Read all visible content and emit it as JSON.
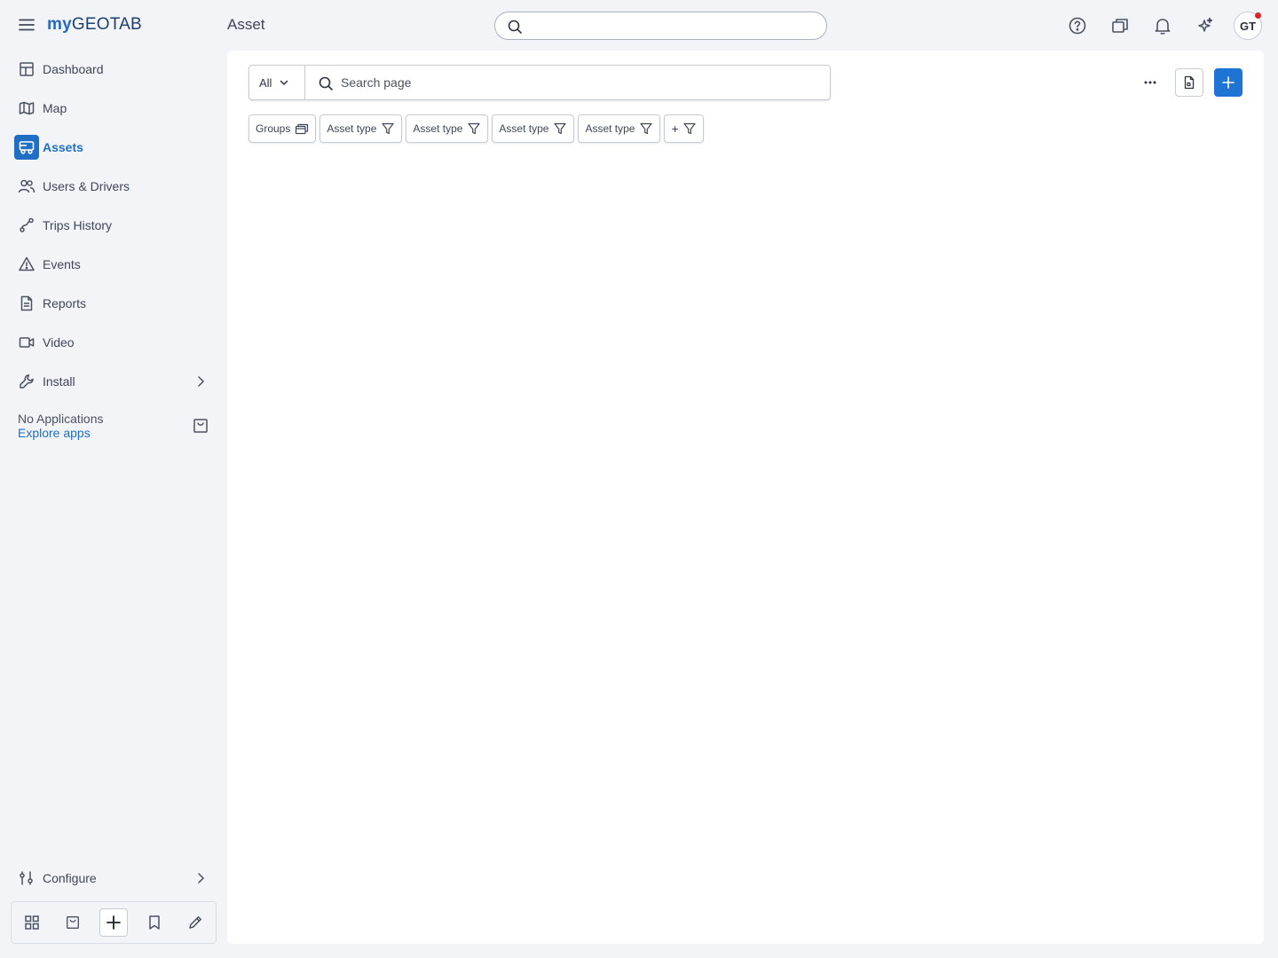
{
  "brand": {
    "logo_my": "my",
    "logo_geotab": "GEOTAB"
  },
  "header": {
    "page_title": "Asset",
    "search_placeholder": "",
    "avatar_initials": "GT",
    "icons": [
      "help-circle-icon",
      "news-icon",
      "bell-icon",
      "sparkle-ai-icon"
    ]
  },
  "sidebar": {
    "items": [
      {
        "label": "Dashboard",
        "icon": "dashboard-icon"
      },
      {
        "label": "Map",
        "icon": "map-icon"
      },
      {
        "label": "Assets",
        "icon": "assets-truck-icon",
        "active": true
      },
      {
        "label": "Users & Drivers",
        "icon": "users-icon"
      },
      {
        "label": "Trips History",
        "icon": "trips-route-icon"
      },
      {
        "label": "Events",
        "icon": "warning-triangle-icon"
      },
      {
        "label": "Reports",
        "icon": "report-document-icon"
      },
      {
        "label": "Video",
        "icon": "video-camera-icon"
      },
      {
        "label": "Install",
        "icon": "wrench-icon",
        "has_submenu": true
      }
    ],
    "apps": {
      "status": "No Applications",
      "explore_link": "Explore apps"
    },
    "configure": {
      "label": "Configure"
    },
    "bottom_bar": [
      "grid-icon",
      "marketplace-bag-icon",
      "add-icon",
      "bookmark-icon",
      "edit-pencil-icon"
    ]
  },
  "toolbar": {
    "scope_value": "All",
    "search_placeholder": "Search page"
  },
  "filters": {
    "chips": [
      {
        "label": "Groups",
        "icon": "groups-folder-icon"
      },
      {
        "label": "Asset type",
        "icon": "filter-icon"
      },
      {
        "label": "Asset type",
        "icon": "filter-icon"
      },
      {
        "label": "Asset type",
        "icon": "filter-icon"
      },
      {
        "label": "Asset type",
        "icon": "filter-icon"
      }
    ],
    "add_filter_label": "+"
  },
  "colors": {
    "accent": "#1f74d3",
    "active_nav": "#1f6fc5",
    "background": "#f2f4f7",
    "notification_dot": "#d7262b"
  }
}
